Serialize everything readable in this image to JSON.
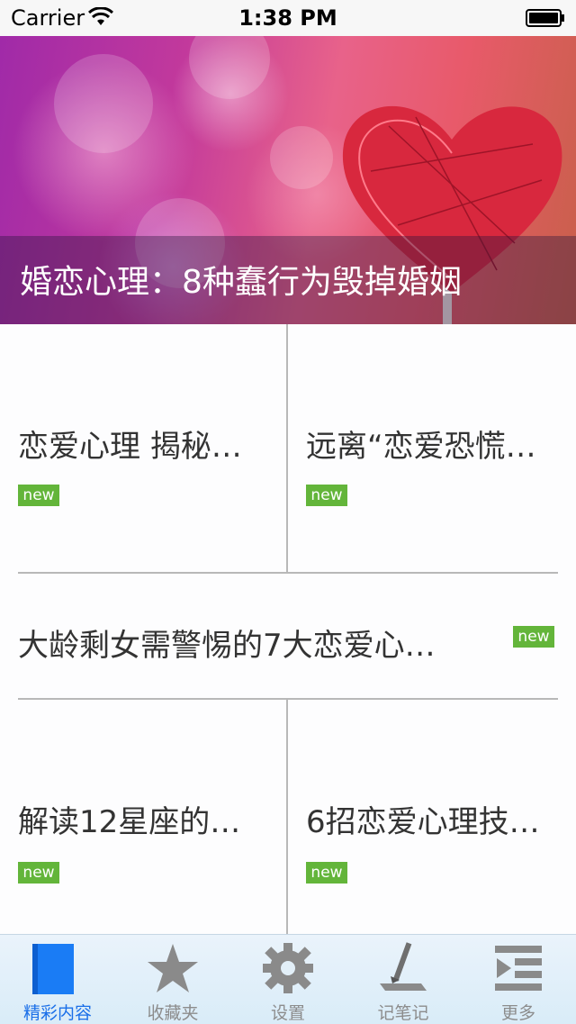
{
  "status_bar": {
    "carrier": "Carrier",
    "time": "1:38 PM"
  },
  "hero": {
    "caption": "婚恋心理：8种蠢行为毁掉婚姻"
  },
  "cards": [
    {
      "title": "恋爱心理 揭秘…",
      "badge": "new"
    },
    {
      "title": "远离“恋爱恐慌…",
      "badge": "new"
    },
    {
      "title": "大龄剩女需警惕的7大恋爱心…",
      "badge": "new"
    },
    {
      "title": "解读12星座的…",
      "badge": "new"
    },
    {
      "title": "6招恋爱心理技…",
      "badge": "new"
    }
  ],
  "tabs": [
    {
      "label": "精彩内容",
      "icon": "book-icon",
      "active": true
    },
    {
      "label": "收藏夹",
      "icon": "star-icon",
      "active": false
    },
    {
      "label": "设置",
      "icon": "gear-icon",
      "active": false
    },
    {
      "label": "记笔记",
      "icon": "pen-icon",
      "active": false
    },
    {
      "label": "更多",
      "icon": "list-icon",
      "active": false
    }
  ],
  "colors": {
    "accent": "#1a6fe8",
    "badge": "#63b53a",
    "tab_inactive": "#8c8c8c"
  }
}
